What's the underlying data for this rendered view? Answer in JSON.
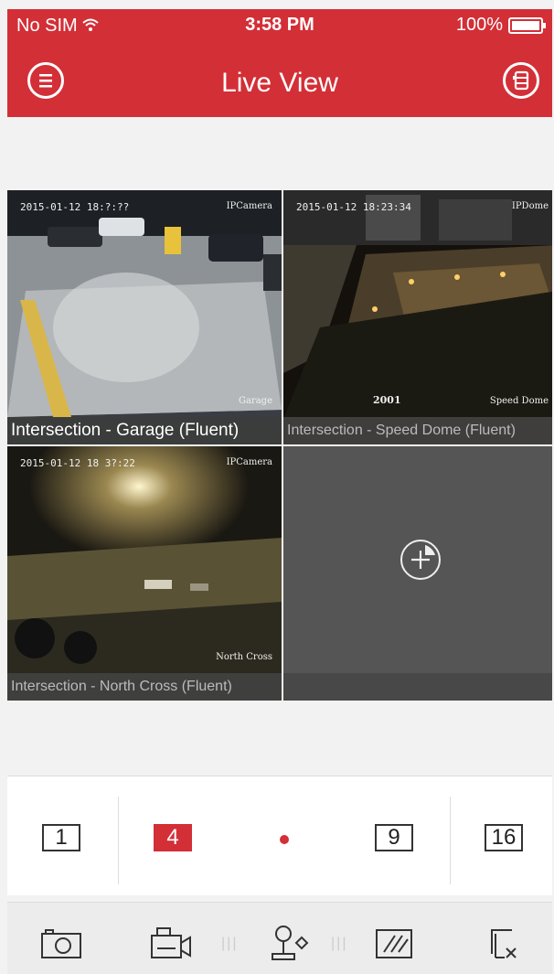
{
  "status_bar": {
    "carrier": "No SIM",
    "time": "3:58 PM",
    "battery": "100%"
  },
  "header": {
    "title": "Live View"
  },
  "cameras": [
    {
      "name": "Intersection - Garage (Fluent)",
      "timestamp": "2015-01-12 18:?:??",
      "cam_label": "IPCamera",
      "osd_name": "Garage",
      "selected": true
    },
    {
      "name": "Intersection - Speed Dome (Fluent)",
      "timestamp": "2015-01-12 18:23:34",
      "cam_label": "IPDome",
      "osd_name": "Speed Dome",
      "osd_number": "2001",
      "selected": false
    },
    {
      "name": "Intersection - North Cross (Fluent)",
      "timestamp": "2015-01-12 18 3?:22",
      "cam_label": "IPCamera",
      "osd_name": "North Cross",
      "selected": false
    }
  ],
  "layout_options": [
    "1",
    "4",
    "9",
    "16"
  ],
  "active_layout": "4",
  "icons": {
    "menu": "menu-icon",
    "switch": "switch-window-icon",
    "add": "add-icon",
    "snapshot": "camera-icon",
    "record": "video-record-icon",
    "ptz": "ptz-icon",
    "image": "image-quality-icon",
    "close_all": "close-all-icon"
  },
  "colors": {
    "accent": "#d32f37",
    "selected_border": "#e3a324"
  }
}
